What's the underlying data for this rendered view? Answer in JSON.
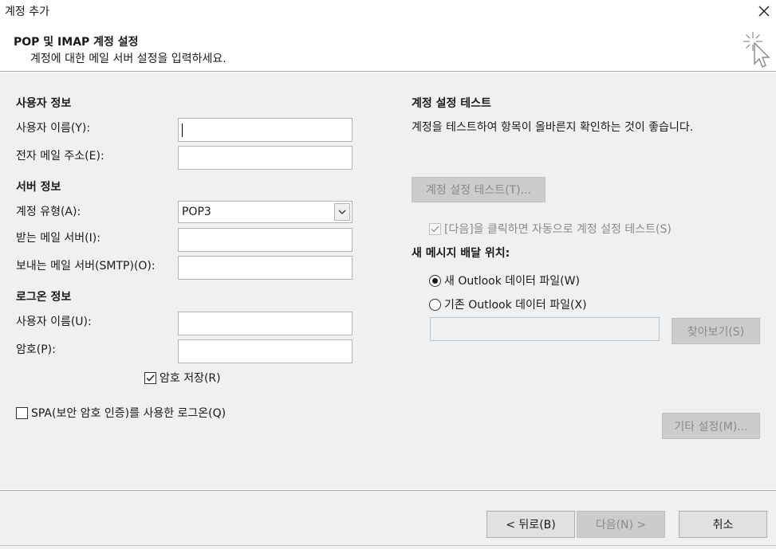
{
  "window": {
    "title": "계정 추가"
  },
  "header": {
    "title": "POP 및 IMAP 계정 설정",
    "subtitle": "계정에 대한 메일 서버 설정을 입력하세요."
  },
  "user_info": {
    "section": "사용자 정보",
    "name_label": "사용자 이름(Y):",
    "name_value": "",
    "email_label": "전자 메일 주소(E):",
    "email_value": ""
  },
  "server_info": {
    "section": "서버 정보",
    "account_type_label": "계정 유형(A):",
    "account_type_value": "POP3",
    "incoming_label": "받는 메일 서버(I):",
    "incoming_value": "",
    "outgoing_label": "보내는 메일 서버(SMTP)(O):",
    "outgoing_value": ""
  },
  "logon_info": {
    "section": "로그온 정보",
    "user_label": "사용자 이름(U):",
    "user_value": "",
    "password_label": "암호(P):",
    "password_value": "",
    "remember_label": "암호 저장(R)",
    "remember_checked": true,
    "spa_label": "SPA(보안 암호 인증)를 사용한 로그온(Q)",
    "spa_checked": false
  },
  "test": {
    "section": "계정 설정 테스트",
    "description": "계정을 테스트하여 항목이 올바른지 확인하는 것이 좋습니다.",
    "button": "계정 설정 테스트(T)...",
    "auto_test_label": "[다음]을 클릭하면 자동으로 계정 설정 테스트(S)",
    "auto_test_checked": true
  },
  "delivery": {
    "section": "새 메시지 배달 위치:",
    "new_file_label": "새 Outlook 데이터 파일(W)",
    "existing_file_label": "기존 Outlook 데이터 파일(X)",
    "selected": "new",
    "path_value": "",
    "browse_button": "찾아보기(S)"
  },
  "more_settings_button": "기타 설정(M)...",
  "footer": {
    "back_button": "< 뒤로(B)",
    "next_button": "다음(N) >",
    "cancel_button": "취소"
  },
  "colors": {
    "panel_bg": "#f0f0f0",
    "disabled_btn": "#cccccc",
    "disabled_text": "#8a8a8a"
  }
}
